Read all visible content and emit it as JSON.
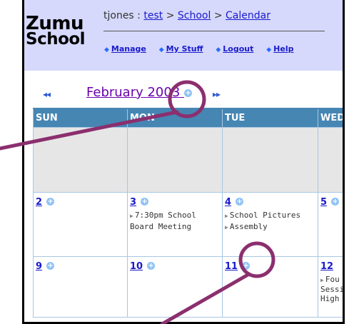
{
  "header": {
    "logo_line1": "Zumu",
    "logo_line2": "School",
    "breadcrumb": {
      "user": "tjones",
      "sep1": " : ",
      "test": "test",
      "sep2": " > ",
      "school": "School",
      "sep3": " > ",
      "calendar": "Calendar"
    },
    "nav": [
      "Manage",
      "My Stuff",
      "Logout",
      "Help"
    ]
  },
  "calendar": {
    "prev_arrows": "◂◂",
    "next_arrows": "▸▸",
    "month_label": "February 2003",
    "days": [
      "SUN",
      "MON",
      "TUE",
      "WED"
    ],
    "weeks": [
      [
        {
          "day": ""
        },
        {
          "day": ""
        },
        {
          "day": ""
        },
        {
          "day": ""
        }
      ],
      [
        {
          "day": "2",
          "events": []
        },
        {
          "day": "3",
          "events": [
            "7:30pm School",
            "Board Meeting"
          ]
        },
        {
          "day": "4",
          "events": [
            "School Pictures",
            "Assembly"
          ]
        },
        {
          "day": "5",
          "events": []
        }
      ],
      [
        {
          "day": "9",
          "events": []
        },
        {
          "day": "10",
          "events": []
        },
        {
          "day": "11",
          "events": []
        },
        {
          "day": "12",
          "events": [
            "Fou",
            "Sessi",
            "High"
          ]
        }
      ]
    ]
  },
  "annotation_color": "#8b2f6e"
}
